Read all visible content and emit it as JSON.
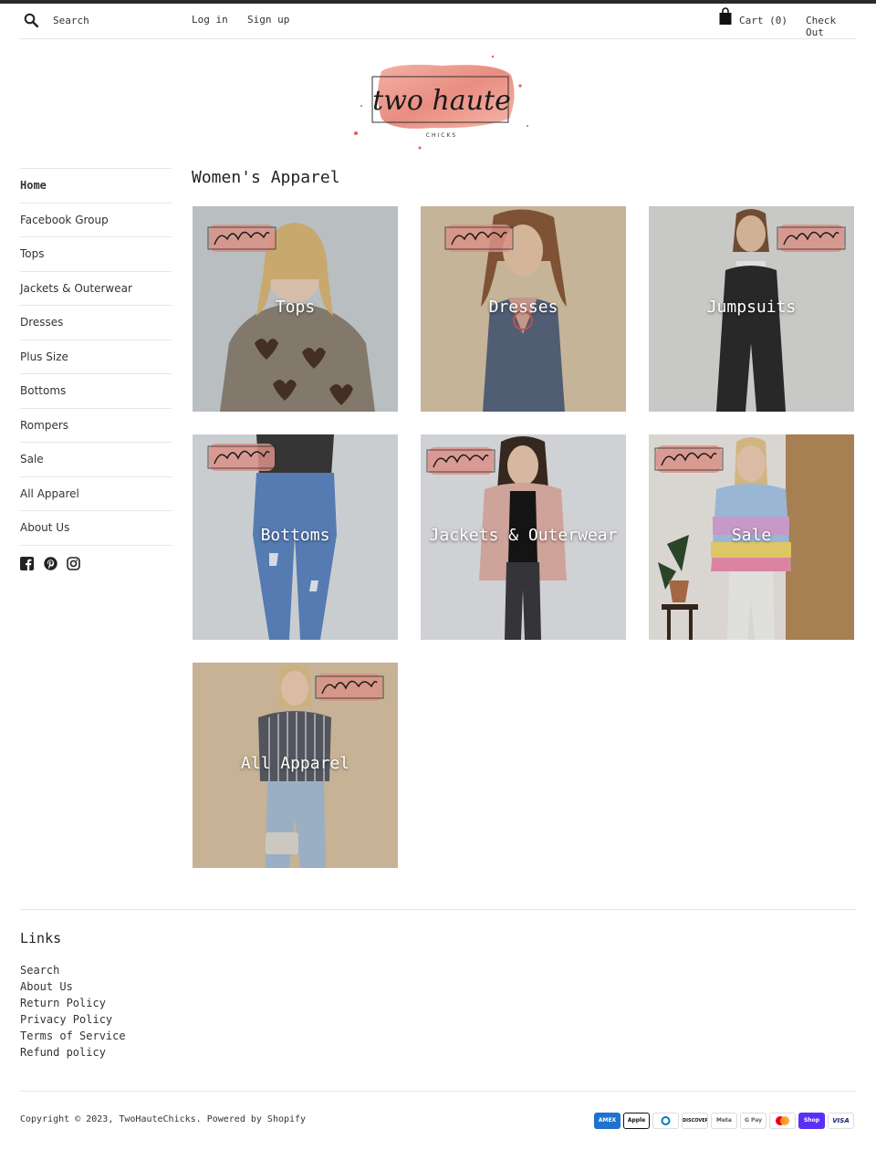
{
  "header": {
    "search_placeholder": "Search",
    "login_label": "Log in",
    "signup_label": "Sign up",
    "cart_label": "Cart (0)",
    "checkout_label": "Check Out"
  },
  "logo": {
    "name": "two haute",
    "tagline": "CHICKS"
  },
  "sidebar": {
    "items": [
      {
        "label": "Home",
        "active": true
      },
      {
        "label": "Facebook Group"
      },
      {
        "label": "Tops"
      },
      {
        "label": "Jackets & Outerwear"
      },
      {
        "label": "Dresses"
      },
      {
        "label": "Plus Size"
      },
      {
        "label": "Bottoms"
      },
      {
        "label": "Rompers"
      },
      {
        "label": "Sale"
      },
      {
        "label": "All Apparel"
      },
      {
        "label": "About Us"
      }
    ],
    "social": [
      "facebook-icon",
      "pinterest-icon",
      "instagram-icon"
    ]
  },
  "main": {
    "title": "Women's Apparel",
    "collections": [
      {
        "label": "Tops"
      },
      {
        "label": "Dresses"
      },
      {
        "label": "Jumpsuits"
      },
      {
        "label": "Bottoms"
      },
      {
        "label": "Jackets & Outerwear"
      },
      {
        "label": "Sale"
      },
      {
        "label": "All Apparel"
      }
    ]
  },
  "footer": {
    "links_title": "Links",
    "links": [
      "Search",
      "About Us",
      "Return Policy",
      "Privacy Policy",
      "Terms of Service",
      "Refund policy"
    ],
    "copyright": "Copyright © 2023, TwoHauteChicks. Powered by Shopify",
    "payment_methods": [
      "AMEX",
      "Apple Pay",
      "Diners Club",
      "DISCOVER",
      "Meta Pay",
      "G Pay",
      "Mastercard",
      "Shop Pay",
      "VISA"
    ]
  },
  "colors": {
    "accent_pink": "#e8958a",
    "rule": "#e6e6e6",
    "text": "#222222"
  }
}
